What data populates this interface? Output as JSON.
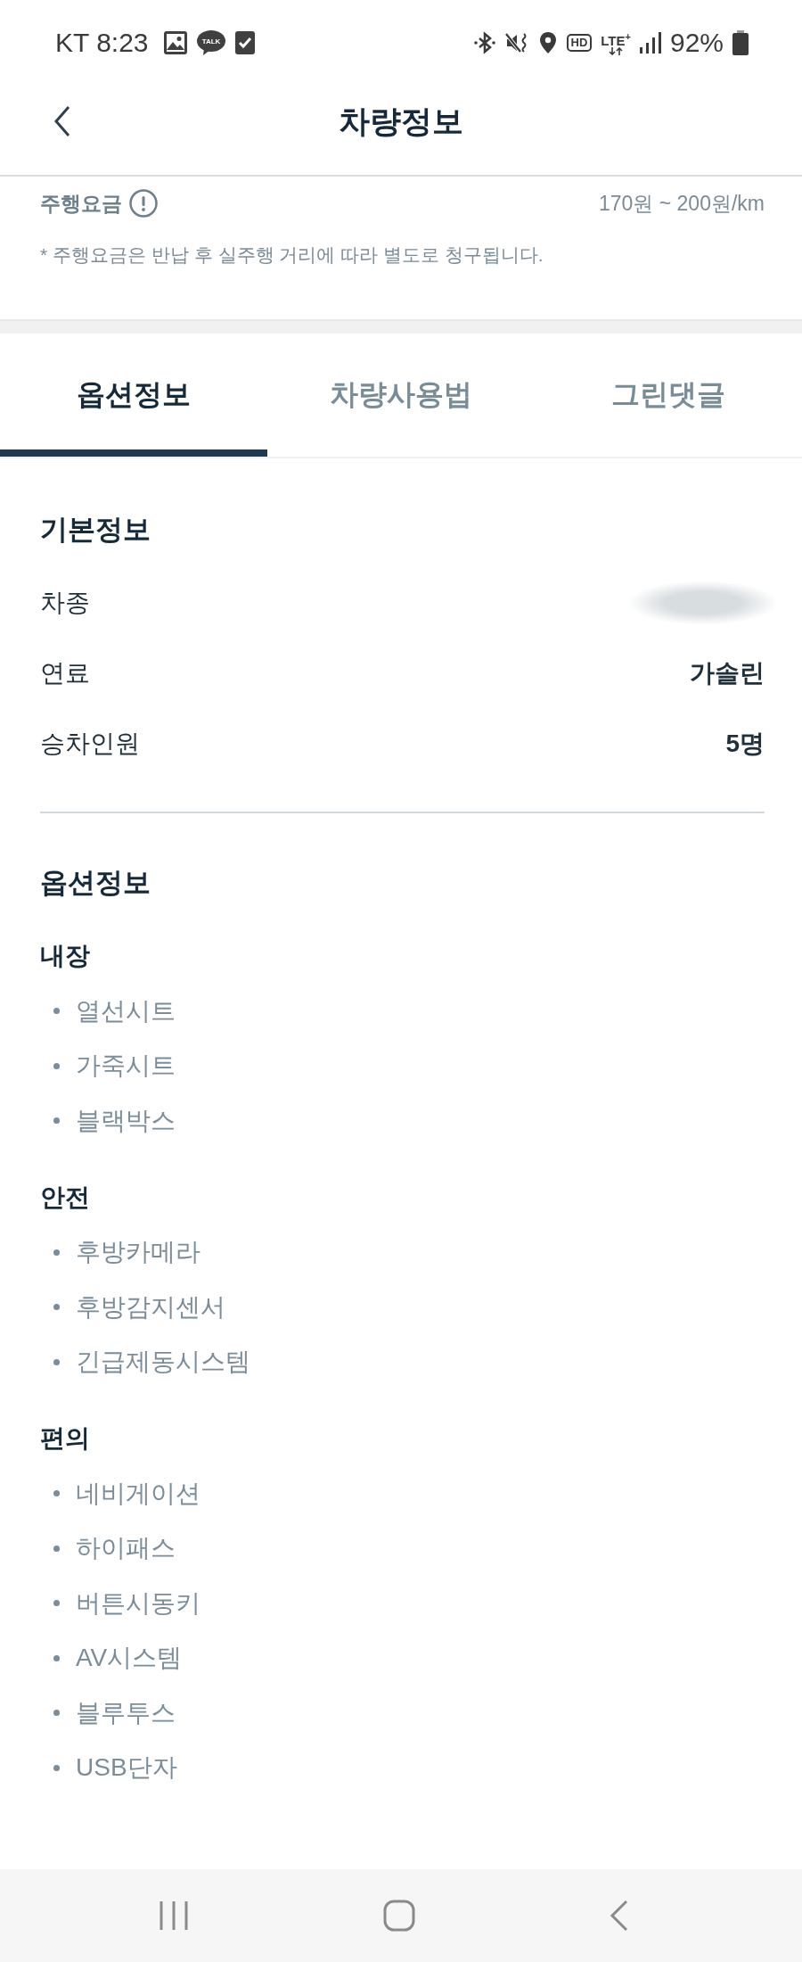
{
  "status_bar": {
    "carrier_time": "KT 8:23",
    "chat_badge": "TALK",
    "hd_badge": "HD",
    "network": "LTE$^{+}$",
    "battery": "92%"
  },
  "header": {
    "title": "차량정보"
  },
  "fare": {
    "label": "주행요금",
    "range": "170원 ~ 200원/km",
    "note": "* 주행요금은 반납 후 실주행 거리에 따라 별도로 청구됩니다."
  },
  "tabs": [
    {
      "label": "옵션정보",
      "selected": true
    },
    {
      "label": "차량사용법",
      "selected": false
    },
    {
      "label": "그린댓글",
      "selected": false
    }
  ],
  "basic_info": {
    "title": "기본정보",
    "rows": [
      {
        "label": "차종",
        "redacted": true
      },
      {
        "label": "연료",
        "value": "가솔린",
        "redacted": false
      },
      {
        "label": "승차인원",
        "value": "5명",
        "redacted": false
      }
    ]
  },
  "options": {
    "title": "옵션정보",
    "groups": [
      {
        "title": "내장",
        "items": [
          "열선시트",
          "가죽시트",
          "블랙박스"
        ]
      },
      {
        "title": "안전",
        "items": [
          "후방카메라",
          "후방감지센서",
          "긴급제동시스템"
        ]
      },
      {
        "title": "편의",
        "items": [
          "네비게이션",
          "하이패스",
          "버튼시동키",
          "AV시스템",
          "블루투스",
          "USB단자"
        ]
      }
    ]
  }
}
